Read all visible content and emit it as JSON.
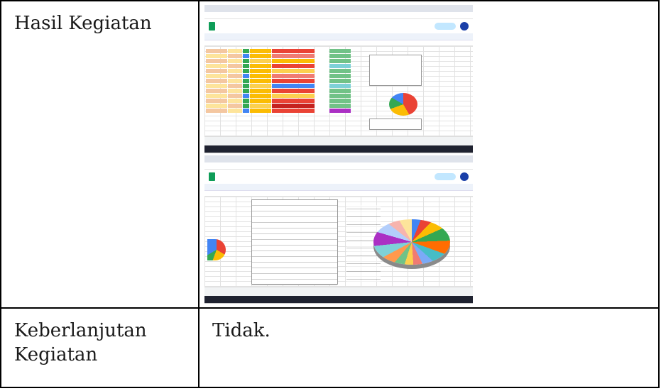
{
  "rows": [
    {
      "label": "Hasil Kegiatan",
      "value": "",
      "screenshots": [
        {
          "app": "Google Sheets",
          "view": "sheet-table"
        },
        {
          "app": "Google Sheets",
          "view": "pie-chart"
        }
      ]
    },
    {
      "label_lines": [
        "Keberlanjutan",
        "Kegiatan"
      ],
      "value": "Tidak."
    }
  ],
  "colors": {
    "border": "#000000",
    "sheets_green": "#0f9d58",
    "share_button": "#c2e7ff",
    "pie_palette": [
      "#4285f4",
      "#ea4335",
      "#fbbc04",
      "#34a853",
      "#ff6d01",
      "#46bdc6"
    ]
  }
}
